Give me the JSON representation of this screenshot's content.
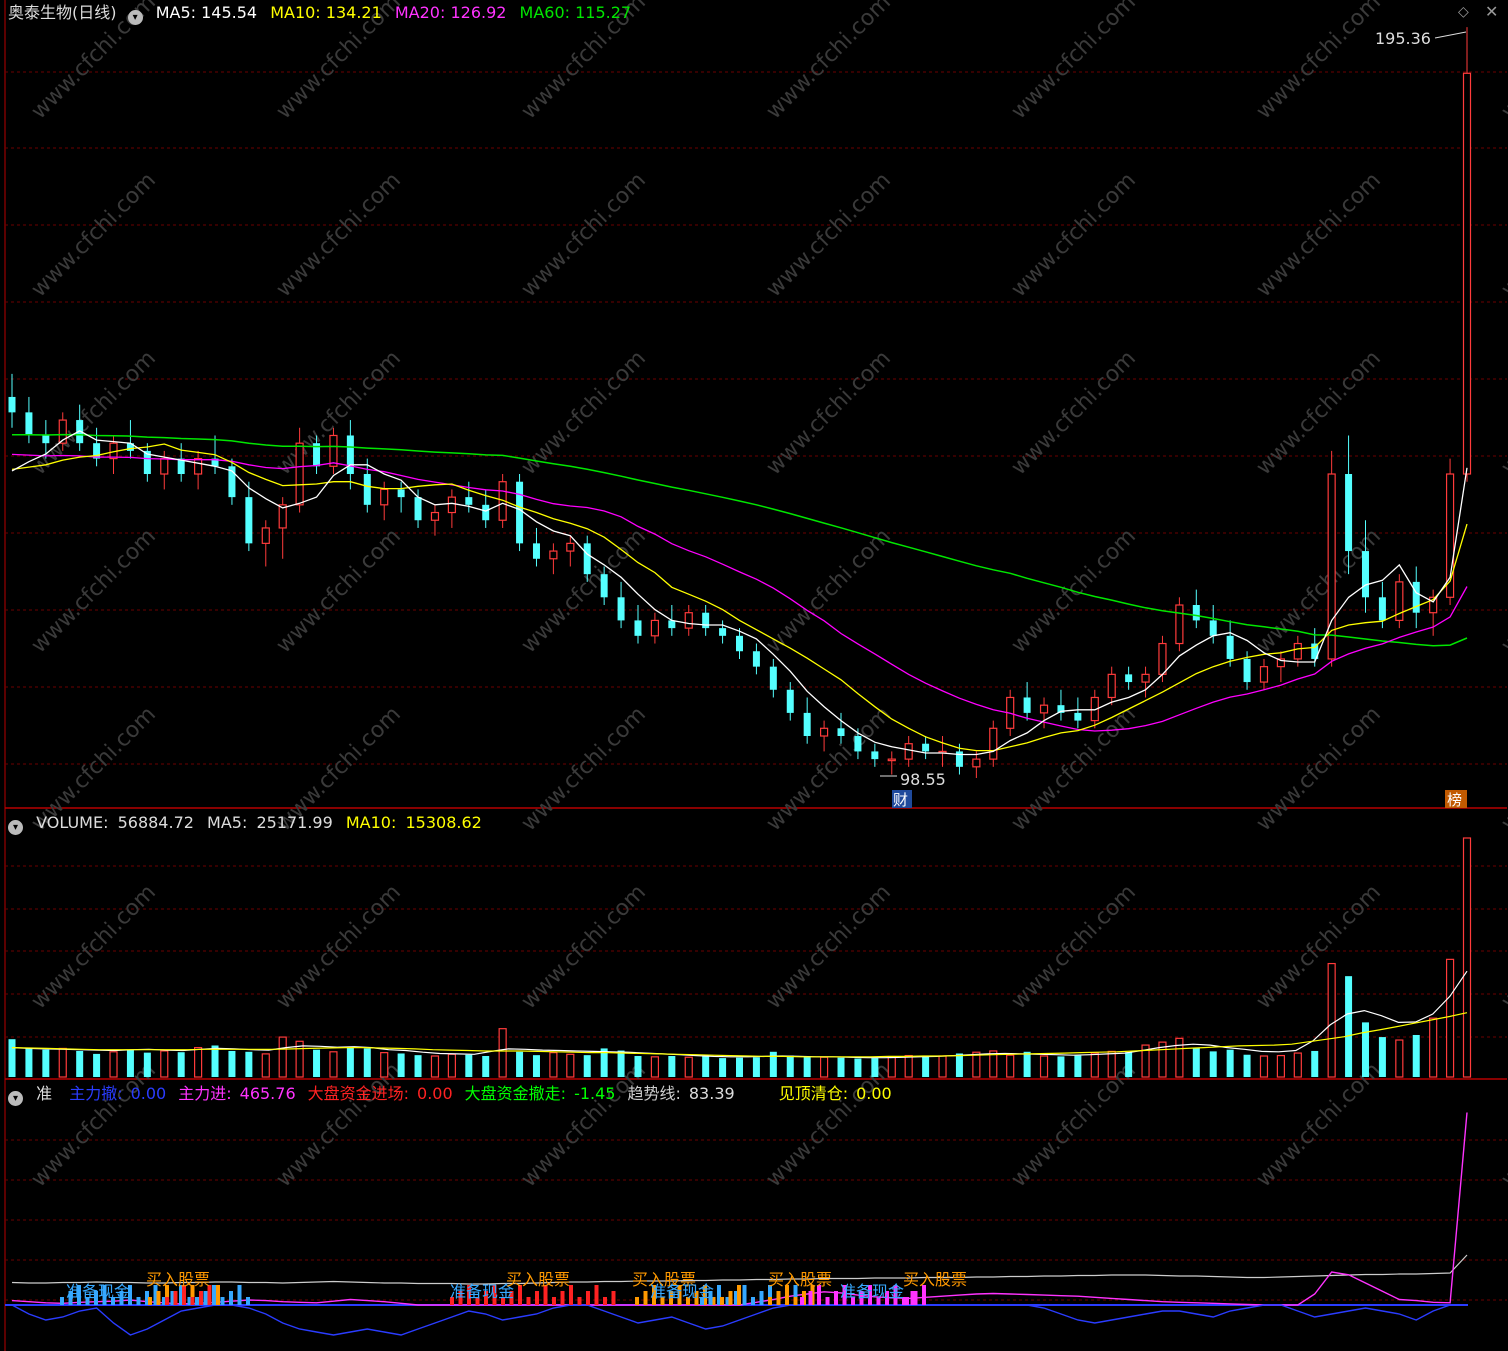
{
  "colors": {
    "up": "#ff3b3b",
    "down": "#54ffff",
    "ma5": "#ffffff",
    "ma10": "#ffff00",
    "ma20": "#ff00ff",
    "ma60": "#00e600",
    "frame": "#b80000",
    "grid": "#6b0000",
    "watermark": "#3a3a3a"
  },
  "icons": [
    "circle-chevron-icon",
    "diamond-icon",
    "close-icon"
  ],
  "price_panel": {
    "stock": "奥泰生物(日线)",
    "ma5_label": "MA5:",
    "ma5": "145.54",
    "ma10_label": "MA10:",
    "ma10": "134.21",
    "ma20_label": "MA20:",
    "ma20": "126.92",
    "ma60_label": "MA60:",
    "ma60": "115.27",
    "high_label": "195.36",
    "low_label": "98.55",
    "badge_left": "财",
    "badge_right": "榜"
  },
  "volume_panel": {
    "label": "VOLUME:",
    "value": "56884.72",
    "ma5_label": "MA5:",
    "ma5": "25171.99",
    "ma10_label": "MA10:",
    "ma10": "15308.62"
  },
  "indicator_panel": {
    "name": "准",
    "items": [
      {
        "label": "主力撤:",
        "value": "0.00",
        "color": "#2a3cff"
      },
      {
        "label": "主力进:",
        "value": "465.76",
        "color": "#ff33ff"
      },
      {
        "label": "大盘资金进场:",
        "value": "0.00",
        "color": "#ff2222"
      },
      {
        "label": "大盘资金撤走:",
        "value": "-1.45",
        "color": "#00ff00"
      },
      {
        "label": "趋势线:",
        "value": "83.39",
        "color": "#cccccc"
      },
      {
        "label": "见顶清仓:",
        "value": "0.00",
        "color": "#ffff00"
      }
    ],
    "signals": [
      {
        "text": "准备现金",
        "color": "#36a8ff"
      },
      {
        "text": "买入股票",
        "color": "#ff9900"
      },
      {
        "text": "准备现金",
        "color": "#36a8ff"
      },
      {
        "text": "买入股票",
        "color": "#ff9900"
      },
      {
        "text": "买入股票",
        "color": "#ff9900"
      },
      {
        "text": "准备现金",
        "color": "#36a8ff"
      },
      {
        "text": "买入股票",
        "color": "#ff9900"
      },
      {
        "text": "准备现金",
        "color": "#36a8ff"
      },
      {
        "text": "买入股票",
        "color": "#ff9900"
      }
    ]
  },
  "watermark": "www.cfchi.com",
  "chart_data": [
    {
      "type": "candlestick",
      "title": "奥泰生物(日线)",
      "ylim": [
        98.55,
        195.36
      ],
      "key_points": {
        "high": 195.36,
        "low": 98.55
      },
      "ohlc": [
        [
          148,
          151,
          144,
          146
        ],
        [
          146,
          148,
          142,
          143
        ],
        [
          143,
          145,
          140,
          142
        ],
        [
          142,
          146,
          141,
          145
        ],
        [
          145,
          147,
          141,
          142
        ],
        [
          142,
          144,
          139,
          140
        ],
        [
          140,
          143,
          138,
          142
        ],
        [
          142,
          145,
          140,
          141
        ],
        [
          141,
          142,
          137,
          138
        ],
        [
          138,
          141,
          136,
          140
        ],
        [
          140,
          142,
          137,
          138
        ],
        [
          138,
          141,
          136,
          140
        ],
        [
          140,
          143,
          138,
          139
        ],
        [
          139,
          140,
          134,
          135
        ],
        [
          135,
          137,
          128,
          129
        ],
        [
          129,
          132,
          126,
          131
        ],
        [
          131,
          135,
          127,
          134
        ],
        [
          134,
          144,
          133,
          142
        ],
        [
          142,
          143,
          138,
          139
        ],
        [
          139,
          144,
          138,
          143
        ],
        [
          143,
          145,
          136,
          138
        ],
        [
          138,
          140,
          133,
          134
        ],
        [
          134,
          137,
          132,
          136
        ],
        [
          136,
          137,
          133,
          135
        ],
        [
          135,
          136,
          131,
          132
        ],
        [
          132,
          134,
          130,
          133
        ],
        [
          133,
          136,
          131,
          135
        ],
        [
          135,
          137,
          133,
          134
        ],
        [
          134,
          136,
          131,
          132
        ],
        [
          132,
          138,
          131,
          137
        ],
        [
          137,
          138,
          128,
          129
        ],
        [
          129,
          131,
          126,
          127
        ],
        [
          127,
          129,
          125,
          128
        ],
        [
          128,
          130,
          126,
          129
        ],
        [
          129,
          130,
          124,
          125
        ],
        [
          125,
          126,
          121,
          122
        ],
        [
          122,
          124,
          118,
          119
        ],
        [
          119,
          121,
          116,
          117
        ],
        [
          117,
          120,
          116,
          119
        ],
        [
          119,
          121,
          117,
          118
        ],
        [
          118,
          121,
          117,
          120
        ],
        [
          120,
          121,
          117,
          118
        ],
        [
          118,
          119,
          116,
          117
        ],
        [
          117,
          118,
          114,
          115
        ],
        [
          115,
          116,
          112,
          113
        ],
        [
          113,
          114,
          109,
          110
        ],
        [
          110,
          111,
          106,
          107
        ],
        [
          107,
          109,
          103,
          104
        ],
        [
          104,
          106,
          102,
          105
        ],
        [
          105,
          107,
          103,
          104
        ],
        [
          104,
          105,
          101,
          102
        ],
        [
          102,
          103,
          100,
          101
        ],
        [
          101,
          102,
          99,
          101
        ],
        [
          101,
          104,
          100,
          103
        ],
        [
          103,
          104,
          101,
          102
        ],
        [
          102,
          104,
          100,
          102
        ],
        [
          102,
          103,
          99,
          100
        ],
        [
          100,
          102,
          98.55,
          101
        ],
        [
          101,
          106,
          100,
          105
        ],
        [
          105,
          110,
          104,
          109
        ],
        [
          109,
          111,
          106,
          107
        ],
        [
          107,
          109,
          105,
          108
        ],
        [
          108,
          110,
          106,
          107
        ],
        [
          107,
          109,
          105,
          106
        ],
        [
          106,
          110,
          105,
          109
        ],
        [
          109,
          113,
          108,
          112
        ],
        [
          112,
          113,
          110,
          111
        ],
        [
          111,
          113,
          109,
          112
        ],
        [
          112,
          117,
          111,
          116
        ],
        [
          116,
          122,
          115,
          121
        ],
        [
          121,
          123,
          118,
          119
        ],
        [
          119,
          121,
          116,
          117
        ],
        [
          117,
          119,
          113,
          114
        ],
        [
          114,
          115,
          110,
          111
        ],
        [
          111,
          114,
          110,
          113
        ],
        [
          113,
          115,
          111,
          114
        ],
        [
          114,
          117,
          113,
          116
        ],
        [
          116,
          118,
          113,
          114
        ],
        [
          114,
          141,
          113,
          138
        ],
        [
          138,
          143,
          125,
          128
        ],
        [
          128,
          132,
          120,
          122
        ],
        [
          122,
          124,
          118,
          119
        ],
        [
          119,
          125,
          118,
          124
        ],
        [
          124,
          126,
          118,
          120
        ],
        [
          120,
          123,
          117,
          122
        ],
        [
          122,
          140,
          121,
          138
        ],
        [
          138,
          196,
          137,
          190
        ]
      ]
    },
    {
      "type": "bar",
      "title": "VOLUME",
      "values": [
        9000,
        7000,
        6500,
        6800,
        6200,
        5500,
        6000,
        6500,
        5800,
        6200,
        5900,
        7000,
        7500,
        6200,
        6000,
        5500,
        9500,
        8500,
        6500,
        6000,
        7200,
        6800,
        5800,
        5600,
        5200,
        5000,
        5400,
        5300,
        5000,
        11500,
        6000,
        5200,
        5800,
        5400,
        5200,
        6800,
        6300,
        5000,
        4800,
        5000,
        4700,
        4900,
        4500,
        4600,
        4700,
        6000,
        5100,
        4800,
        4700,
        4600,
        4400,
        4500,
        4700,
        5100,
        4800,
        5000,
        5600,
        5900,
        6200,
        5200,
        6000,
        5000,
        4900,
        5100,
        5700,
        6100,
        5900,
        7600,
        8300,
        9200,
        7000,
        6100,
        6500,
        5300,
        5000,
        5100,
        5700,
        6200,
        27000,
        24000,
        13000,
        9500,
        8800,
        10000,
        14000,
        28000,
        56884.72
      ],
      "ma5": [
        7000,
        6800,
        6700,
        6600,
        6500,
        6400,
        6300,
        6500,
        6600,
        6400,
        6300,
        6600,
        6800,
        6700,
        6500,
        6400,
        7000,
        7400,
        7300,
        7100,
        7200,
        7000,
        6500,
        6300,
        5900,
        5600,
        5500,
        5400,
        6100,
        6700,
        6600,
        6400,
        6300,
        6200,
        6100,
        6000,
        5900,
        5700,
        5500,
        5300,
        5100,
        4900,
        4800,
        4800,
        4900,
        5000,
        4900,
        4800,
        4800,
        4700,
        4600,
        4600,
        4700,
        4800,
        4900,
        5100,
        5300,
        5500,
        5600,
        5500,
        5400,
        5300,
        5200,
        5300,
        5500,
        5700,
        6300,
        7000,
        7500,
        7800,
        7600,
        7000,
        6600,
        6100,
        6000,
        6300,
        8600,
        12400,
        15000,
        15800,
        14600,
        13000,
        13100,
        15000,
        19200,
        25171.99
      ],
      "ma10": [
        7000,
        6900,
        6800,
        6700,
        6600,
        6500,
        6500,
        6500,
        6500,
        6500,
        6500,
        6600,
        6600,
        6600,
        6600,
        6600,
        6700,
        6800,
        6900,
        7000,
        7000,
        6900,
        6800,
        6700,
        6500,
        6400,
        6300,
        6200,
        6200,
        6200,
        6100,
        6000,
        5900,
        5800,
        5800,
        5700,
        5600,
        5500,
        5400,
        5300,
        5200,
        5100,
        5000,
        4900,
        4900,
        4800,
        4800,
        4800,
        4800,
        4800,
        4900,
        4900,
        5000,
        5000,
        5100,
        5200,
        5300,
        5400,
        5500,
        5600,
        5700,
        5800,
        5900,
        6000,
        6200,
        6400,
        6600,
        6800,
        7000,
        7200,
        7400,
        7500,
        7600,
        7800,
        8400,
        9000,
        9600,
        10500,
        11200,
        12000,
        12800,
        13600,
        14400,
        15308.62
      ]
    },
    {
      "type": "line",
      "title": "准",
      "series": [
        {
          "name": "主力进",
          "values": [
            8,
            6,
            4,
            3,
            5,
            6,
            7,
            9,
            6,
            4,
            2,
            3,
            5,
            7,
            9,
            8,
            6,
            5,
            4,
            7,
            10,
            8,
            6,
            3,
            0,
            0,
            0,
            0,
            0,
            0,
            0,
            0,
            0,
            0,
            0,
            0,
            0,
            0,
            0,
            0,
            0,
            0,
            0,
            0,
            5,
            10,
            16,
            20,
            24,
            22,
            18,
            15,
            13,
            12,
            14,
            16,
            18,
            20,
            21,
            20,
            19,
            18,
            17,
            16,
            14,
            12,
            10,
            8,
            6,
            5,
            4,
            3,
            2,
            1,
            0,
            0,
            0,
            20,
            60,
            55,
            40,
            25,
            10,
            8,
            5,
            4,
            465.76
          ]
        },
        {
          "name": "趋势线",
          "values": [
            5,
            4,
            4,
            5,
            5,
            6,
            5,
            5,
            4,
            4,
            5,
            5,
            6,
            6,
            5,
            5,
            4,
            5,
            6,
            7,
            6,
            5,
            4,
            4,
            3,
            3,
            3,
            2,
            2,
            3,
            3,
            4,
            5,
            6,
            6,
            7,
            7,
            8,
            8,
            8,
            9,
            9,
            10,
            10,
            11,
            11,
            12,
            12,
            13,
            13,
            13,
            14,
            14,
            14,
            15,
            15,
            15,
            16,
            16,
            17,
            17,
            18,
            18,
            19,
            19,
            20,
            20,
            20,
            19,
            18,
            18,
            17,
            16,
            15,
            15,
            16,
            17,
            18,
            19,
            20,
            21,
            21,
            22,
            22,
            23,
            24,
            83.39
          ]
        },
        {
          "name": "主力撤",
          "values": [
            0,
            -3,
            -5,
            -4,
            -2,
            -1,
            -6,
            -10,
            -8,
            -5,
            -2,
            -1,
            0,
            0,
            -1,
            -3,
            -6,
            -8,
            -9,
            -10,
            -9,
            -8,
            -9,
            -10,
            -8,
            -6,
            -4,
            -2,
            -3,
            -5,
            -4,
            -3,
            -1,
            0,
            0,
            -2,
            -4,
            -6,
            -5,
            -4,
            -6,
            -8,
            -7,
            -5,
            -3,
            -1,
            0,
            0,
            0,
            0,
            0,
            0,
            0,
            0,
            0,
            0,
            0,
            0,
            0,
            0,
            0,
            -1,
            -3,
            -5,
            -6,
            -5,
            -4,
            -3,
            -2,
            -2,
            -3,
            -4,
            -2,
            -1,
            0,
            0,
            -2,
            -4,
            -3,
            -2,
            -1,
            -2,
            -3,
            -5,
            -2,
            0,
            0
          ]
        }
      ]
    }
  ]
}
